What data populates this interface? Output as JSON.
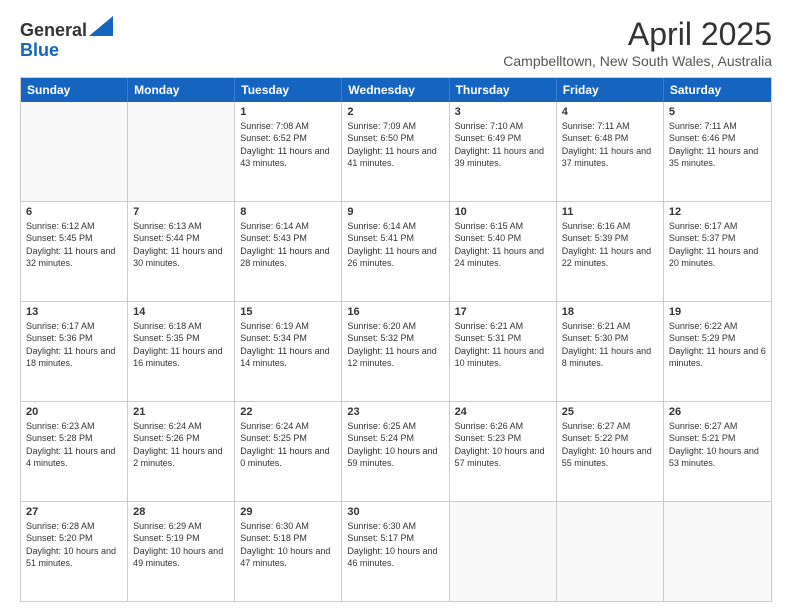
{
  "logo": {
    "general": "General",
    "blue": "Blue"
  },
  "header": {
    "month": "April 2025",
    "location": "Campbelltown, New South Wales, Australia"
  },
  "weekdays": [
    "Sunday",
    "Monday",
    "Tuesday",
    "Wednesday",
    "Thursday",
    "Friday",
    "Saturday"
  ],
  "weeks": [
    [
      {
        "day": "",
        "empty": true
      },
      {
        "day": "",
        "empty": true
      },
      {
        "day": "1",
        "rise": "Sunrise: 7:08 AM",
        "set": "Sunset: 6:52 PM",
        "light": "Daylight: 11 hours and 43 minutes."
      },
      {
        "day": "2",
        "rise": "Sunrise: 7:09 AM",
        "set": "Sunset: 6:50 PM",
        "light": "Daylight: 11 hours and 41 minutes."
      },
      {
        "day": "3",
        "rise": "Sunrise: 7:10 AM",
        "set": "Sunset: 6:49 PM",
        "light": "Daylight: 11 hours and 39 minutes."
      },
      {
        "day": "4",
        "rise": "Sunrise: 7:11 AM",
        "set": "Sunset: 6:48 PM",
        "light": "Daylight: 11 hours and 37 minutes."
      },
      {
        "day": "5",
        "rise": "Sunrise: 7:11 AM",
        "set": "Sunset: 6:46 PM",
        "light": "Daylight: 11 hours and 35 minutes."
      }
    ],
    [
      {
        "day": "6",
        "rise": "Sunrise: 6:12 AM",
        "set": "Sunset: 5:45 PM",
        "light": "Daylight: 11 hours and 32 minutes."
      },
      {
        "day": "7",
        "rise": "Sunrise: 6:13 AM",
        "set": "Sunset: 5:44 PM",
        "light": "Daylight: 11 hours and 30 minutes."
      },
      {
        "day": "8",
        "rise": "Sunrise: 6:14 AM",
        "set": "Sunset: 5:43 PM",
        "light": "Daylight: 11 hours and 28 minutes."
      },
      {
        "day": "9",
        "rise": "Sunrise: 6:14 AM",
        "set": "Sunset: 5:41 PM",
        "light": "Daylight: 11 hours and 26 minutes."
      },
      {
        "day": "10",
        "rise": "Sunrise: 6:15 AM",
        "set": "Sunset: 5:40 PM",
        "light": "Daylight: 11 hours and 24 minutes."
      },
      {
        "day": "11",
        "rise": "Sunrise: 6:16 AM",
        "set": "Sunset: 5:39 PM",
        "light": "Daylight: 11 hours and 22 minutes."
      },
      {
        "day": "12",
        "rise": "Sunrise: 6:17 AM",
        "set": "Sunset: 5:37 PM",
        "light": "Daylight: 11 hours and 20 minutes."
      }
    ],
    [
      {
        "day": "13",
        "rise": "Sunrise: 6:17 AM",
        "set": "Sunset: 5:36 PM",
        "light": "Daylight: 11 hours and 18 minutes."
      },
      {
        "day": "14",
        "rise": "Sunrise: 6:18 AM",
        "set": "Sunset: 5:35 PM",
        "light": "Daylight: 11 hours and 16 minutes."
      },
      {
        "day": "15",
        "rise": "Sunrise: 6:19 AM",
        "set": "Sunset: 5:34 PM",
        "light": "Daylight: 11 hours and 14 minutes."
      },
      {
        "day": "16",
        "rise": "Sunrise: 6:20 AM",
        "set": "Sunset: 5:32 PM",
        "light": "Daylight: 11 hours and 12 minutes."
      },
      {
        "day": "17",
        "rise": "Sunrise: 6:21 AM",
        "set": "Sunset: 5:31 PM",
        "light": "Daylight: 11 hours and 10 minutes."
      },
      {
        "day": "18",
        "rise": "Sunrise: 6:21 AM",
        "set": "Sunset: 5:30 PM",
        "light": "Daylight: 11 hours and 8 minutes."
      },
      {
        "day": "19",
        "rise": "Sunrise: 6:22 AM",
        "set": "Sunset: 5:29 PM",
        "light": "Daylight: 11 hours and 6 minutes."
      }
    ],
    [
      {
        "day": "20",
        "rise": "Sunrise: 6:23 AM",
        "set": "Sunset: 5:28 PM",
        "light": "Daylight: 11 hours and 4 minutes."
      },
      {
        "day": "21",
        "rise": "Sunrise: 6:24 AM",
        "set": "Sunset: 5:26 PM",
        "light": "Daylight: 11 hours and 2 minutes."
      },
      {
        "day": "22",
        "rise": "Sunrise: 6:24 AM",
        "set": "Sunset: 5:25 PM",
        "light": "Daylight: 11 hours and 0 minutes."
      },
      {
        "day": "23",
        "rise": "Sunrise: 6:25 AM",
        "set": "Sunset: 5:24 PM",
        "light": "Daylight: 10 hours and 59 minutes."
      },
      {
        "day": "24",
        "rise": "Sunrise: 6:26 AM",
        "set": "Sunset: 5:23 PM",
        "light": "Daylight: 10 hours and 57 minutes."
      },
      {
        "day": "25",
        "rise": "Sunrise: 6:27 AM",
        "set": "Sunset: 5:22 PM",
        "light": "Daylight: 10 hours and 55 minutes."
      },
      {
        "day": "26",
        "rise": "Sunrise: 6:27 AM",
        "set": "Sunset: 5:21 PM",
        "light": "Daylight: 10 hours and 53 minutes."
      }
    ],
    [
      {
        "day": "27",
        "rise": "Sunrise: 6:28 AM",
        "set": "Sunset: 5:20 PM",
        "light": "Daylight: 10 hours and 51 minutes."
      },
      {
        "day": "28",
        "rise": "Sunrise: 6:29 AM",
        "set": "Sunset: 5:19 PM",
        "light": "Daylight: 10 hours and 49 minutes."
      },
      {
        "day": "29",
        "rise": "Sunrise: 6:30 AM",
        "set": "Sunset: 5:18 PM",
        "light": "Daylight: 10 hours and 47 minutes."
      },
      {
        "day": "30",
        "rise": "Sunrise: 6:30 AM",
        "set": "Sunset: 5:17 PM",
        "light": "Daylight: 10 hours and 46 minutes."
      },
      {
        "day": "",
        "empty": true
      },
      {
        "day": "",
        "empty": true
      },
      {
        "day": "",
        "empty": true
      }
    ]
  ]
}
